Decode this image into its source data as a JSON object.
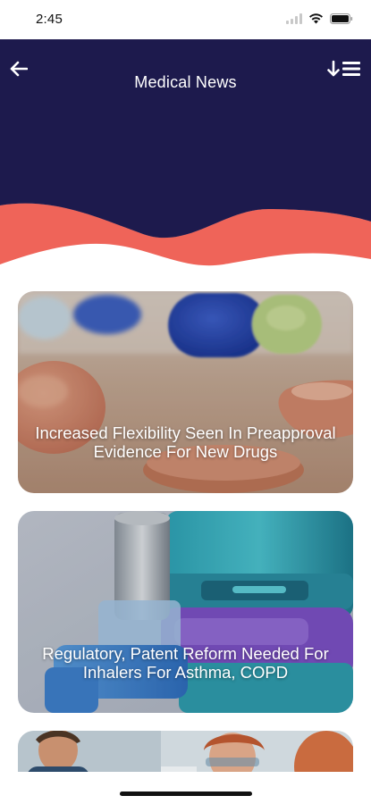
{
  "status_bar": {
    "time": "2:45"
  },
  "header": {
    "title": "Medical News",
    "colors": {
      "navy": "#1d1a4d",
      "coral": "#ef6459"
    }
  },
  "news": [
    {
      "title": "Increased Flexibility Seen In Preapproval Evidence For New Drugs",
      "image": "pills-on-table"
    },
    {
      "title": "Regulatory, Patent Reform Needed For Inhalers For Asthma, COPD",
      "image": "asthma-inhalers"
    },
    {
      "title": "",
      "image": "healthcare-workers"
    }
  ]
}
